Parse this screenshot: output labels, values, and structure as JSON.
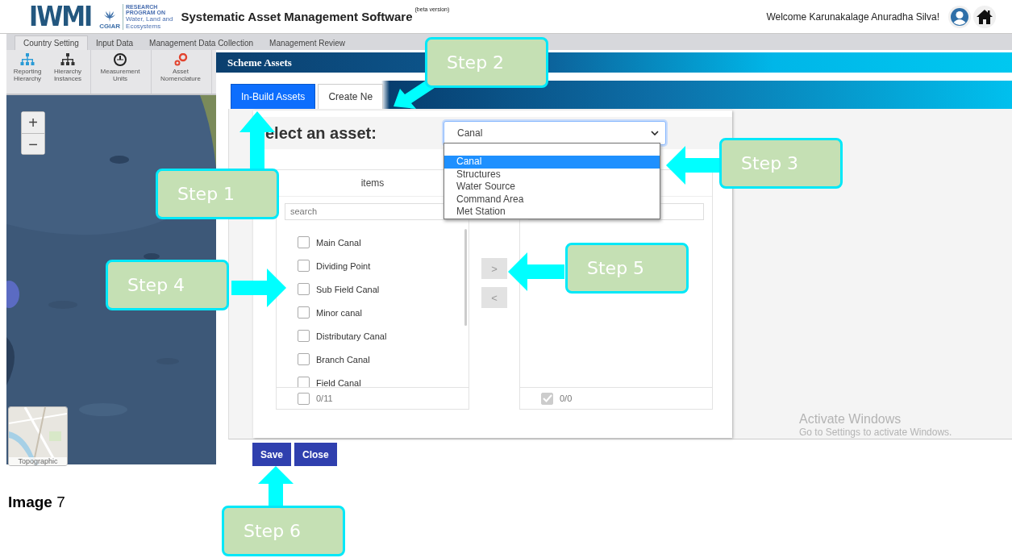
{
  "header": {
    "logo": "IWMI",
    "partner": {
      "name": "CGIAR",
      "lines": [
        "RESEARCH",
        "PROGRAM ON",
        "Water, Land and",
        "Ecosystems"
      ]
    },
    "title": "Systematic Asset Management Software",
    "title_note": "(beta version)",
    "welcome": "Welcome Karunakalage Anuradha Silva!"
  },
  "nav_tabs": [
    {
      "label": "Country Setting",
      "selected": true
    },
    {
      "label": "Input Data",
      "selected": false
    },
    {
      "label": "Management Data Collection",
      "selected": false
    },
    {
      "label": "Management Review",
      "selected": false
    }
  ],
  "toolbar": [
    [
      {
        "label": "Reporting Hierarchy",
        "kind": "reporting"
      },
      {
        "label": "Hierarchy Instances",
        "kind": "instances"
      }
    ],
    [
      {
        "label": "Measurement Units",
        "kind": "gauge"
      }
    ],
    [
      {
        "label": "Asset Nomenclature",
        "kind": "gears"
      }
    ]
  ],
  "map": {
    "zoom_in": "+",
    "zoom_out": "−",
    "basemap": "Topographic"
  },
  "modal": {
    "title": "Scheme Assets",
    "tabs": [
      {
        "label": "In-Build Assets",
        "selected": true
      },
      {
        "label": "Create Ne",
        "selected": false
      }
    ],
    "asset_label": "elect an asset:",
    "asset_select": "Canal",
    "asset_options": [
      {
        "label": "Canal",
        "selected": true
      },
      {
        "label": "Structures",
        "selected": false
      },
      {
        "label": "Water Source",
        "selected": false
      },
      {
        "label": "Command Area",
        "selected": false
      },
      {
        "label": "Met Station",
        "selected": false
      }
    ],
    "source_list": {
      "header": "items",
      "placeholder": "search",
      "items": [
        {
          "label": "Main Canal",
          "checked": false
        },
        {
          "label": "Dividing Point",
          "checked": false
        },
        {
          "label": "Sub Field Canal",
          "checked": false
        },
        {
          "label": "Minor canal",
          "checked": false
        },
        {
          "label": "Distributary Canal",
          "checked": false
        },
        {
          "label": "Branch Canal",
          "checked": false
        },
        {
          "label": "Field Canal",
          "checked": false
        }
      ],
      "count": "0/11",
      "all_checked": false
    },
    "move_buttons": [
      ">",
      "<"
    ],
    "target_list": {
      "count": "0/0",
      "all_checked": true
    },
    "buttons": [
      "Save",
      "Close"
    ]
  },
  "os_notice": {
    "title": "Activate Windows",
    "text": "Go to Settings to activate Windows."
  },
  "steps": [
    "Step 1",
    "Step 2",
    "Step 3",
    "Step 4",
    "Step 5",
    "Step 6"
  ],
  "caption": "**Image** 7"
}
